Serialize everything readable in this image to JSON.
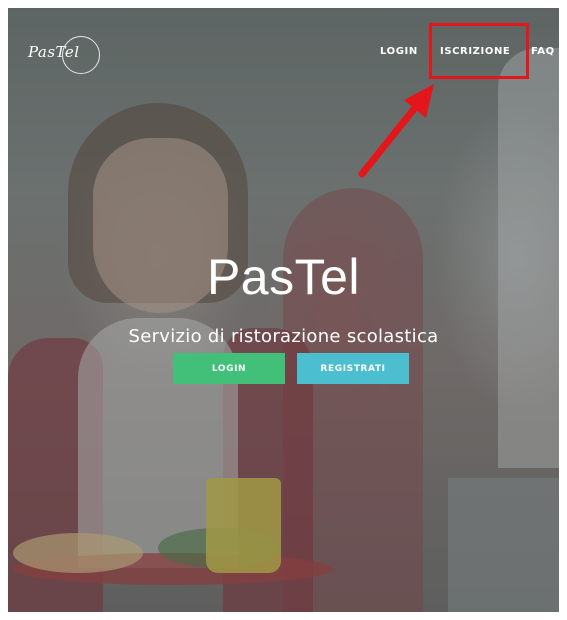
{
  "logo": {
    "text": "PasTel"
  },
  "nav": {
    "login": "LOGIN",
    "iscrizione": "ISCRIZIONE",
    "faq": "FAQ"
  },
  "hero": {
    "title": "PasTel",
    "subtitle": "Servizio di ristorazione scolastica",
    "login_button": "LOGIN",
    "register_button": "REGISTRATI"
  },
  "colors": {
    "login_button": "#42c07a",
    "register_button": "#4bbfd0",
    "annotation_red": "#e3161b"
  }
}
